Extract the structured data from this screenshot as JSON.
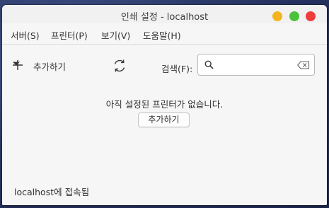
{
  "window": {
    "title": "인쇄 설정 - localhost"
  },
  "menubar": {
    "items": [
      {
        "label": "서버(S)"
      },
      {
        "label": "프린터(P)"
      },
      {
        "label": "보기(V)"
      },
      {
        "label": "도움말(H)"
      }
    ]
  },
  "toolbar": {
    "add_label": "추가하기",
    "search_label": "검색(F):",
    "search_value": "",
    "icons": [
      "plus-icon",
      "dropdown-arrow-icon",
      "refresh-icon",
      "search-icon",
      "clear-icon"
    ]
  },
  "content": {
    "empty_message": "아직 설정된 프린터가 없습니다.",
    "add_button_label": "추가하기"
  },
  "statusbar": {
    "text": "localhost에 접속됨"
  },
  "colors": {
    "minimize": "#f3b51f",
    "maximize": "#4cc13b",
    "close": "#ef3d3d"
  }
}
